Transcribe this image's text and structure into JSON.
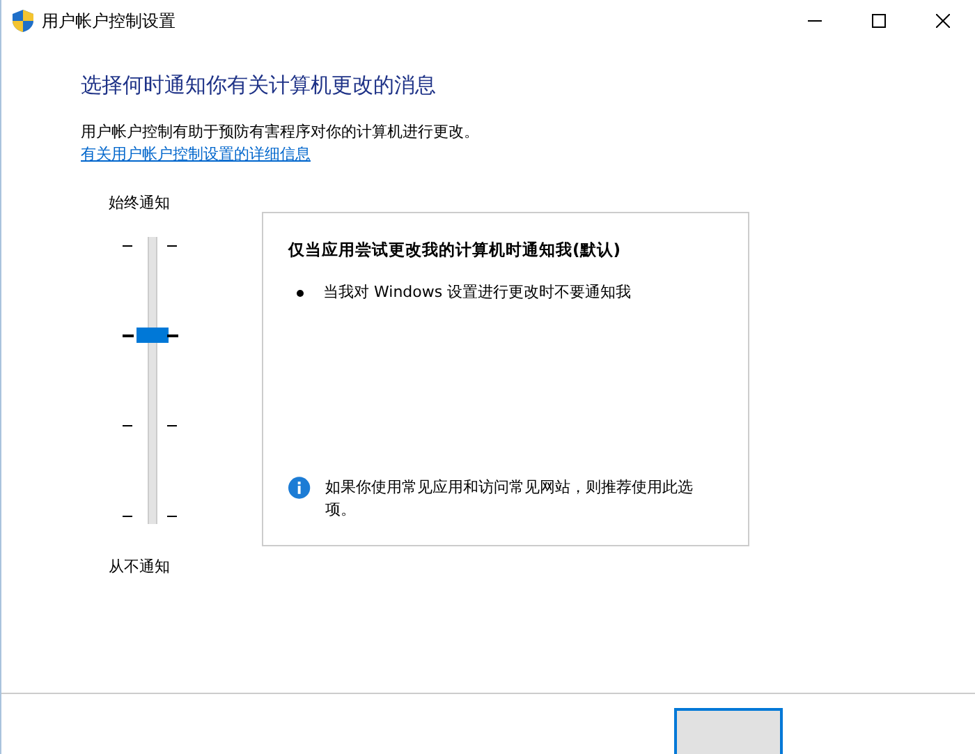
{
  "window": {
    "title": "用户帐户控制设置"
  },
  "heading": "选择何时通知你有关计算机更改的消息",
  "intro": "用户帐户控制有助于预防有害程序对你的计算机进行更改。",
  "link": "有关用户帐户控制设置的详细信息",
  "slider": {
    "top_label": "始终通知",
    "bottom_label": "从不通知",
    "level": 0.667
  },
  "description": {
    "title": "仅当应用尝试更改我的计算机时通知我(默认)",
    "bullets": [
      "当我对 Windows 设置进行更改时不要通知我"
    ],
    "note": "如果你使用常见应用和访问常见网站，则推荐使用此选项。"
  },
  "footer_buttons": [
    {
      "is_default": true
    }
  ]
}
